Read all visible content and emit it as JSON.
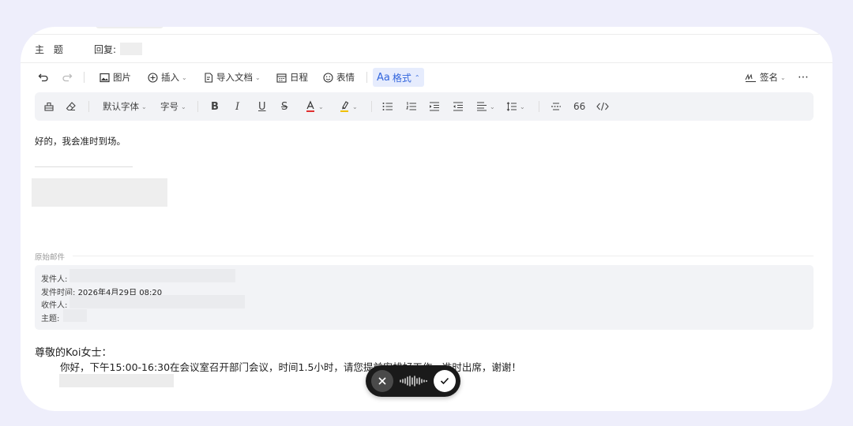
{
  "compose": {
    "subject_label": "主 题",
    "subject_prefix": "回复:",
    "toolbar": {
      "undo": "undo",
      "redo": "redo",
      "image": "图片",
      "insert": "插入",
      "import_doc": "导入文档",
      "schedule": "日程",
      "emoji": "表情",
      "format": "格式",
      "format_prefix": "Aa",
      "signature": "签名"
    },
    "format_bar": {
      "font": "默认字体",
      "size": "字号",
      "quote": "66"
    },
    "reply_text": "好的，我会准时到场。"
  },
  "original": {
    "label": "原始邮件",
    "from_label": "发件人:",
    "time_label": "发件时间:",
    "time_value": "2026年4月29日 08:20",
    "to_label": "收件人:",
    "subject_label": "主题:",
    "greeting": "尊敬的Koi女士：",
    "body": "你好，下午15:00-16:30在会议室召开部门会议，时间1.5小时，请您提前安排好工作，准时出席，谢谢！"
  },
  "colors": {
    "background": "#eeeefb",
    "accent": "#3366dd",
    "font_color_mark": "#e03030",
    "highlight_mark": "#f0c000",
    "pill": "#1a1a1a"
  },
  "icons": [
    "undo-icon",
    "redo-icon",
    "image-icon",
    "plus-circle-icon",
    "document-icon",
    "calendar-icon",
    "smile-icon",
    "signature-icon",
    "more-icon",
    "format-painter-icon",
    "eraser-icon",
    "bold-icon",
    "italic-icon",
    "underline-icon",
    "strikethrough-icon",
    "font-color-icon",
    "highlight-icon",
    "bullet-list-icon",
    "numbered-list-icon",
    "indent-icon",
    "outdent-icon",
    "align-icon",
    "line-height-icon",
    "divider-icon",
    "code-icon",
    "close-icon",
    "waveform-icon",
    "check-icon"
  ]
}
